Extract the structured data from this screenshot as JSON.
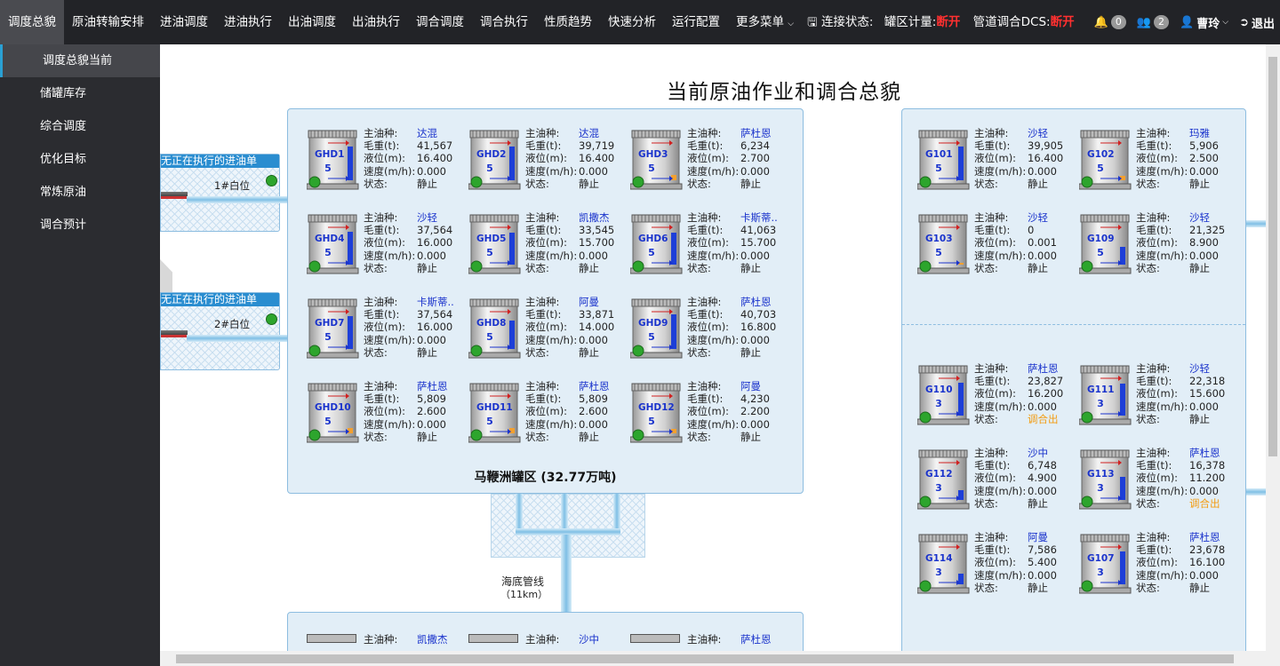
{
  "nav": {
    "items": [
      "调度总貌",
      "原油转输安排",
      "进油调度",
      "进油执行",
      "出油调度",
      "出油执行",
      "调合调度",
      "调合执行",
      "性质趋势",
      "快速分析",
      "运行配置",
      "更多菜单"
    ],
    "active": 0,
    "connect_label": "连接状态:",
    "tank_meter_label": "罐区计量:",
    "tank_meter_status": "断开",
    "dcs_label": "管道调合DCS:",
    "dcs_status": "断开",
    "bell_count": "0",
    "group_count": "2",
    "user": "曹玲",
    "logout": "退出"
  },
  "sidebar": {
    "items": [
      "调度总貌当前",
      "储罐库存",
      "综合调度",
      "优化目标",
      "常炼原油",
      "调合预计"
    ]
  },
  "page": {
    "title": "当前原油作业和调合总貌",
    "pipeline_label": "海底管线",
    "pipeline_len": "（11km）"
  },
  "labels": {
    "oil": "主油种:",
    "weight": "毛重(t):",
    "level": "液位(m):",
    "speed": "速度(m/h):",
    "state": "状态:"
  },
  "berths": [
    {
      "head": "无正在执行的进油单",
      "name": "1#白位"
    },
    {
      "head": "无正在执行的进油单",
      "name": "2#白位"
    }
  ],
  "zone_a": {
    "title": "马鞭洲罐区 (32.77万吨)",
    "tanks": [
      {
        "id": "GHD1",
        "num": "5",
        "oil": "达混",
        "weight": "41,567",
        "level": "16.400",
        "speed": "0.000",
        "state": "静止",
        "fill": 0.82
      },
      {
        "id": "GHD2",
        "num": "5",
        "oil": "达混",
        "weight": "39,719",
        "level": "16.400",
        "speed": "0.000",
        "state": "静止",
        "fill": 0.82
      },
      {
        "id": "GHD3",
        "num": "5",
        "oil": "萨杜恩",
        "weight": "6,234",
        "level": "2.700",
        "speed": "0.000",
        "state": "静止",
        "fill": 0.12
      },
      {
        "id": "GHD4",
        "num": "5",
        "oil": "沙轻",
        "weight": "37,564",
        "level": "16.000",
        "speed": "0.000",
        "state": "静止",
        "fill": 0.8
      },
      {
        "id": "GHD5",
        "num": "5",
        "oil": "凯撒杰",
        "weight": "33,545",
        "level": "15.700",
        "speed": "0.000",
        "state": "静止",
        "fill": 0.78
      },
      {
        "id": "GHD6",
        "num": "5",
        "oil": "卡斯蒂..",
        "weight": "41,063",
        "level": "15.700",
        "speed": "0.000",
        "state": "静止",
        "fill": 0.78
      },
      {
        "id": "GHD7",
        "num": "5",
        "oil": "卡斯蒂..",
        "weight": "37,564",
        "level": "16.000",
        "speed": "0.000",
        "state": "静止",
        "fill": 0.8
      },
      {
        "id": "GHD8",
        "num": "5",
        "oil": "阿曼",
        "weight": "33,871",
        "level": "14.000",
        "speed": "0.000",
        "state": "静止",
        "fill": 0.7
      },
      {
        "id": "GHD9",
        "num": "5",
        "oil": "萨杜恩",
        "weight": "40,703",
        "level": "16.800",
        "speed": "0.000",
        "state": "静止",
        "fill": 0.84
      },
      {
        "id": "GHD10",
        "num": "5",
        "oil": "萨杜恩",
        "weight": "5,809",
        "level": "2.600",
        "speed": "0.000",
        "state": "静止",
        "fill": 0.12
      },
      {
        "id": "GHD11",
        "num": "5",
        "oil": "萨杜恩",
        "weight": "5,809",
        "level": "2.600",
        "speed": "0.000",
        "state": "静止",
        "fill": 0.12
      },
      {
        "id": "GHD12",
        "num": "5",
        "oil": "阿曼",
        "weight": "4,230",
        "level": "2.200",
        "speed": "0.000",
        "state": "静止",
        "fill": 0.1
      }
    ]
  },
  "zone_b": {
    "tanks": [
      {
        "oil": "凯撒杰"
      },
      {
        "oil": "沙中"
      },
      {
        "oil": "萨杜恩"
      }
    ]
  },
  "zone_c": {
    "tanks_top": [
      {
        "id": "G101",
        "num": "5",
        "oil": "沙轻",
        "weight": "39,905",
        "level": "16.400",
        "speed": "0.000",
        "state": "静止",
        "fill": 0.82
      },
      {
        "id": "G102",
        "num": "5",
        "oil": "玛雅",
        "weight": "5,906",
        "level": "2.500",
        "speed": "0.000",
        "state": "静止",
        "fill": 0.1
      },
      {
        "id": "G103",
        "num": "5",
        "oil": "沙轻",
        "weight": "0",
        "level": "0.001",
        "speed": "0.000",
        "state": "静止",
        "fill": 0.0
      },
      {
        "id": "G109",
        "num": "5",
        "oil": "沙轻",
        "weight": "21,325",
        "level": "8.900",
        "speed": "0.000",
        "state": "静止",
        "fill": 0.44
      }
    ],
    "tanks_bottom": [
      {
        "id": "G110",
        "num": "3",
        "oil": "萨杜恩",
        "weight": "23,827",
        "level": "16.200",
        "speed": "0.000",
        "state": "调合出",
        "fill": 0.81
      },
      {
        "id": "G111",
        "num": "3",
        "oil": "沙轻",
        "weight": "22,318",
        "level": "15.600",
        "speed": "0.000",
        "state": "静止",
        "fill": 0.78
      },
      {
        "id": "G112",
        "num": "3",
        "oil": "沙中",
        "weight": "6,748",
        "level": "4.900",
        "speed": "0.000",
        "state": "静止",
        "fill": 0.24
      },
      {
        "id": "G113",
        "num": "3",
        "oil": "萨杜恩",
        "weight": "16,378",
        "level": "11.200",
        "speed": "0.000",
        "state": "调合出",
        "fill": 0.56
      },
      {
        "id": "G114",
        "num": "3",
        "oil": "阿曼",
        "weight": "7,586",
        "level": "5.400",
        "speed": "0.000",
        "state": "静止",
        "fill": 0.27
      },
      {
        "id": "G107",
        "num": "3",
        "oil": "萨杜恩",
        "weight": "23,678",
        "level": "16.100",
        "speed": "0.000",
        "state": "静止",
        "fill": 0.8
      }
    ]
  },
  "colors": {
    "blue_text": "#1a33cc",
    "orange_text": "#f39c12",
    "level_bar": "#1d3fd8"
  }
}
